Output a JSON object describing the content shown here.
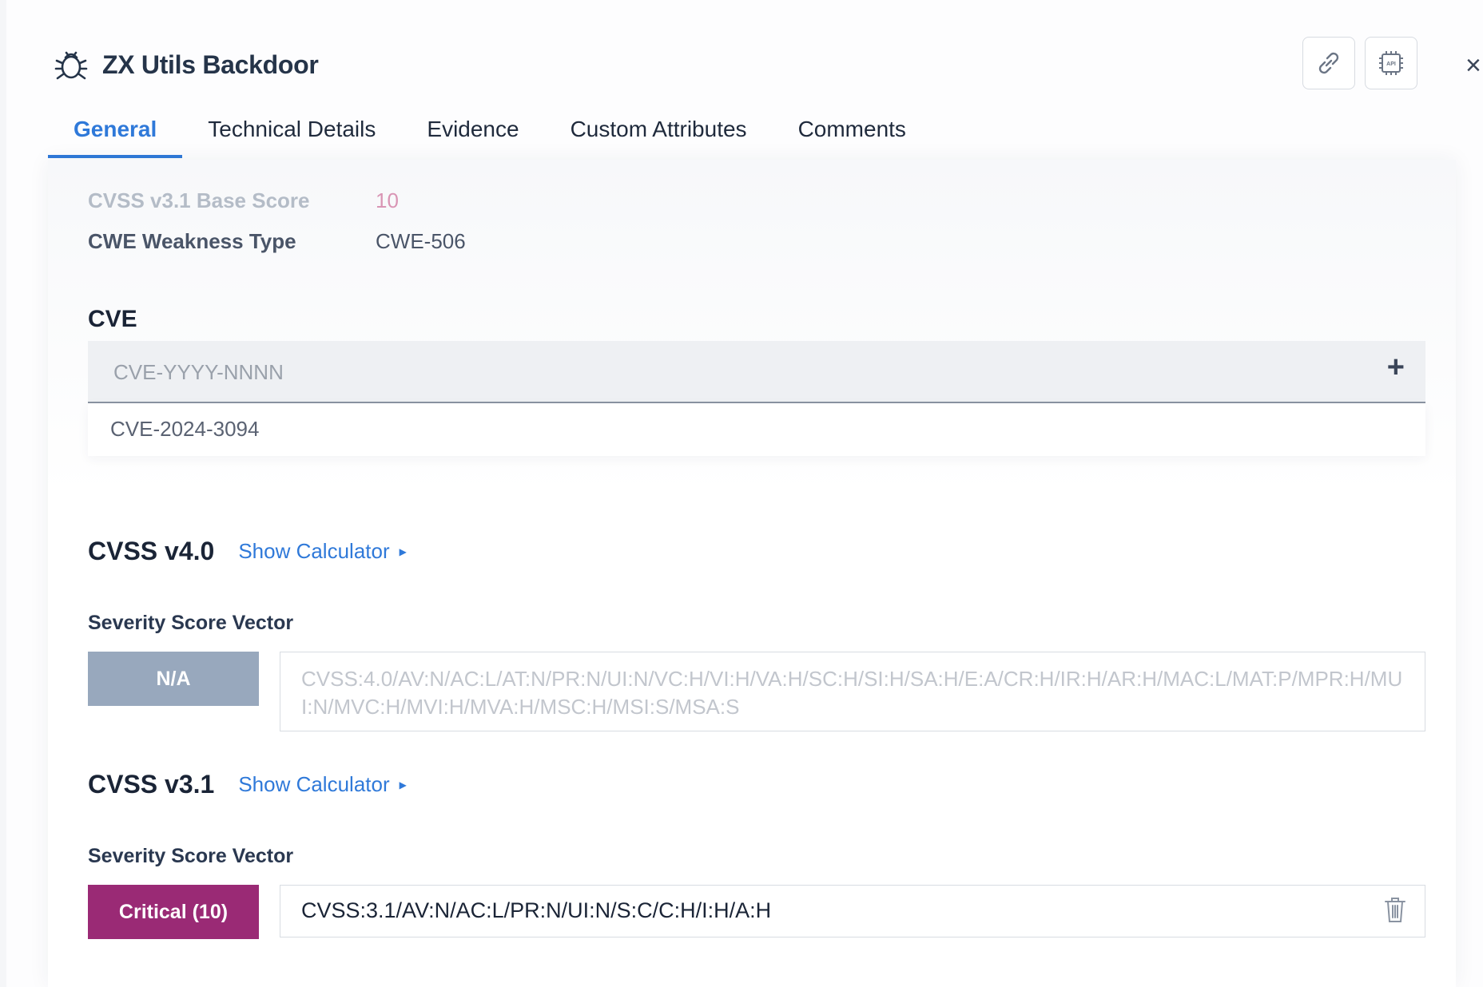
{
  "header": {
    "title": "ZX Utils Backdoor",
    "title_icon": "bug-icon",
    "actions": [
      {
        "name": "copy-link",
        "icon": "link-icon"
      },
      {
        "name": "api",
        "icon": "api-chip-icon",
        "icon_text": "API"
      }
    ],
    "close_label": "×"
  },
  "tabs": [
    {
      "label": "General",
      "active": true
    },
    {
      "label": "Technical Details",
      "active": false
    },
    {
      "label": "Evidence",
      "active": false
    },
    {
      "label": "Custom Attributes",
      "active": false
    },
    {
      "label": "Comments",
      "active": false
    }
  ],
  "details": {
    "cvss31_base_score_label": "CVSS v3.1 Base Score",
    "cvss31_base_score_value": "10",
    "cwe_label": "CWE Weakness Type",
    "cwe_value": "CWE-506"
  },
  "cve": {
    "title": "CVE",
    "placeholder": "CVE-YYYY-NNNN",
    "add_label": "+",
    "entries": [
      "CVE-2024-3094"
    ]
  },
  "cvss_v4": {
    "heading": "CVSS v4.0",
    "show_calculator": "Show Calculator",
    "vector_label": "Severity Score Vector",
    "severity": "N/A",
    "severity_color": "#98a8bd",
    "vector": "CVSS:4.0/AV:N/AC:L/AT:N/PR:N/UI:N/VC:H/VI:H/VA:H/SC:H/SI:H/SA:H/E:A/CR:H/IR:H/AR:H/MAC:L/MAT:P/MPR:H/MUI:N/MVC:H/MVI:H/MVA:H/MSC:H/MSI:S/MSA:S"
  },
  "cvss_v31": {
    "heading": "CVSS v3.1",
    "show_calculator": "Show Calculator",
    "vector_label": "Severity Score Vector",
    "severity": "Critical (10)",
    "severity_color": "#9a2a75",
    "vector": "CVSS:3.1/AV:N/AC:L/PR:N/UI:N/S:C/C:H/I:H/A:H",
    "delete_icon": "trash-icon"
  },
  "colors": {
    "accent": "#2f79d9",
    "critical": "#9a2a75",
    "na": "#98a8bd"
  }
}
